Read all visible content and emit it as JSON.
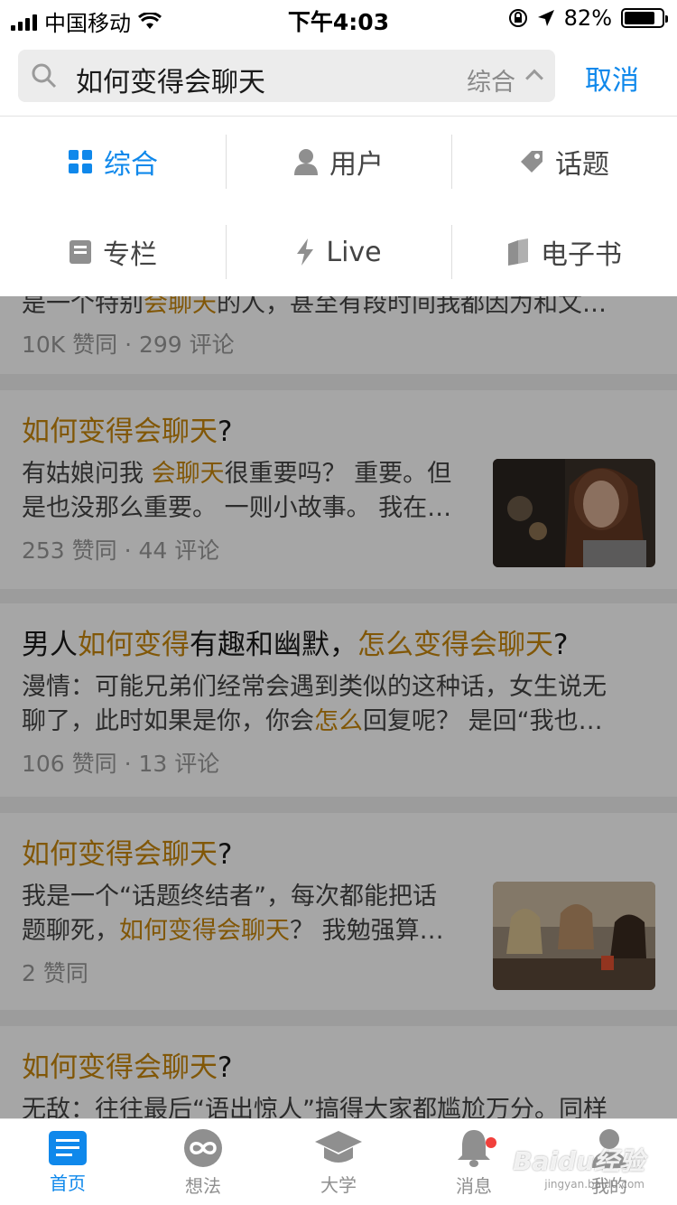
{
  "status_bar": {
    "carrier": "中国移动",
    "time": "下午4:03",
    "battery": "82%",
    "battery_level": 0.82
  },
  "search": {
    "query": "如何变得会聊天",
    "scope": "综合",
    "cancel_label": "取消"
  },
  "filter": {
    "options": [
      {
        "label": "综合",
        "icon": "grid-icon",
        "active": true
      },
      {
        "label": "用户",
        "icon": "user-icon"
      },
      {
        "label": "话题",
        "icon": "tag-icon"
      },
      {
        "label": "专栏",
        "icon": "column-icon"
      },
      {
        "label": "Live",
        "icon": "lightning-icon"
      },
      {
        "label": "电子书",
        "icon": "book-icon"
      }
    ]
  },
  "results": [
    {
      "excerpt_parts": [
        "是一个特别",
        "会聊天",
        "的人，甚至有段时间我都因为和文…"
      ],
      "meta": "10K 赞同 · 299 评论"
    },
    {
      "title_parts": [
        "如何变得会聊天",
        "?"
      ],
      "excerpt_l1_parts": [
        "有姑娘问我 ",
        "会聊天",
        "很重要吗？ 重要。但"
      ],
      "excerpt_l2": "是也没那么重要。 一则小故事。 我在…",
      "meta": "253 赞同 · 44 评论"
    },
    {
      "title_parts": [
        "男人",
        "如何变得",
        "有趣和幽默，",
        "怎么变得会聊天",
        "?"
      ],
      "excerpt_l1": "漫情：可能兄弟们经常会遇到类似的这种话，女生说无",
      "excerpt_l2_parts": [
        "聊了，此时如果是你，你会",
        "怎么",
        "回复呢？ 是回“我也…"
      ],
      "meta": "106 赞同 · 13 评论"
    },
    {
      "title_parts": [
        "如何变得会聊天",
        "?"
      ],
      "excerpt_l1": "我是一个“话题终结者”，每次都能把话",
      "excerpt_l2_parts": [
        "题聊死，",
        "如何变得会聊天",
        "？ 我勉强算…"
      ],
      "meta": "2 赞同"
    },
    {
      "title_parts": [
        "如何变得会聊天",
        "?"
      ],
      "excerpt_l1": "无敌：往往最后“语出惊人”搞得大家都尴尬万分。同样"
    }
  ],
  "tabbar": {
    "tabs": [
      {
        "label": "首页",
        "icon": "home-icon",
        "active": true
      },
      {
        "label": "想法",
        "icon": "infinity-icon"
      },
      {
        "label": "大学",
        "icon": "graduation-cap-icon"
      },
      {
        "label": "消息",
        "icon": "bell-icon"
      },
      {
        "label": "我的",
        "icon": "profile-icon"
      }
    ]
  },
  "watermark": {
    "text": "Baidu经验",
    "sub": "jingyan.baidu.com"
  }
}
